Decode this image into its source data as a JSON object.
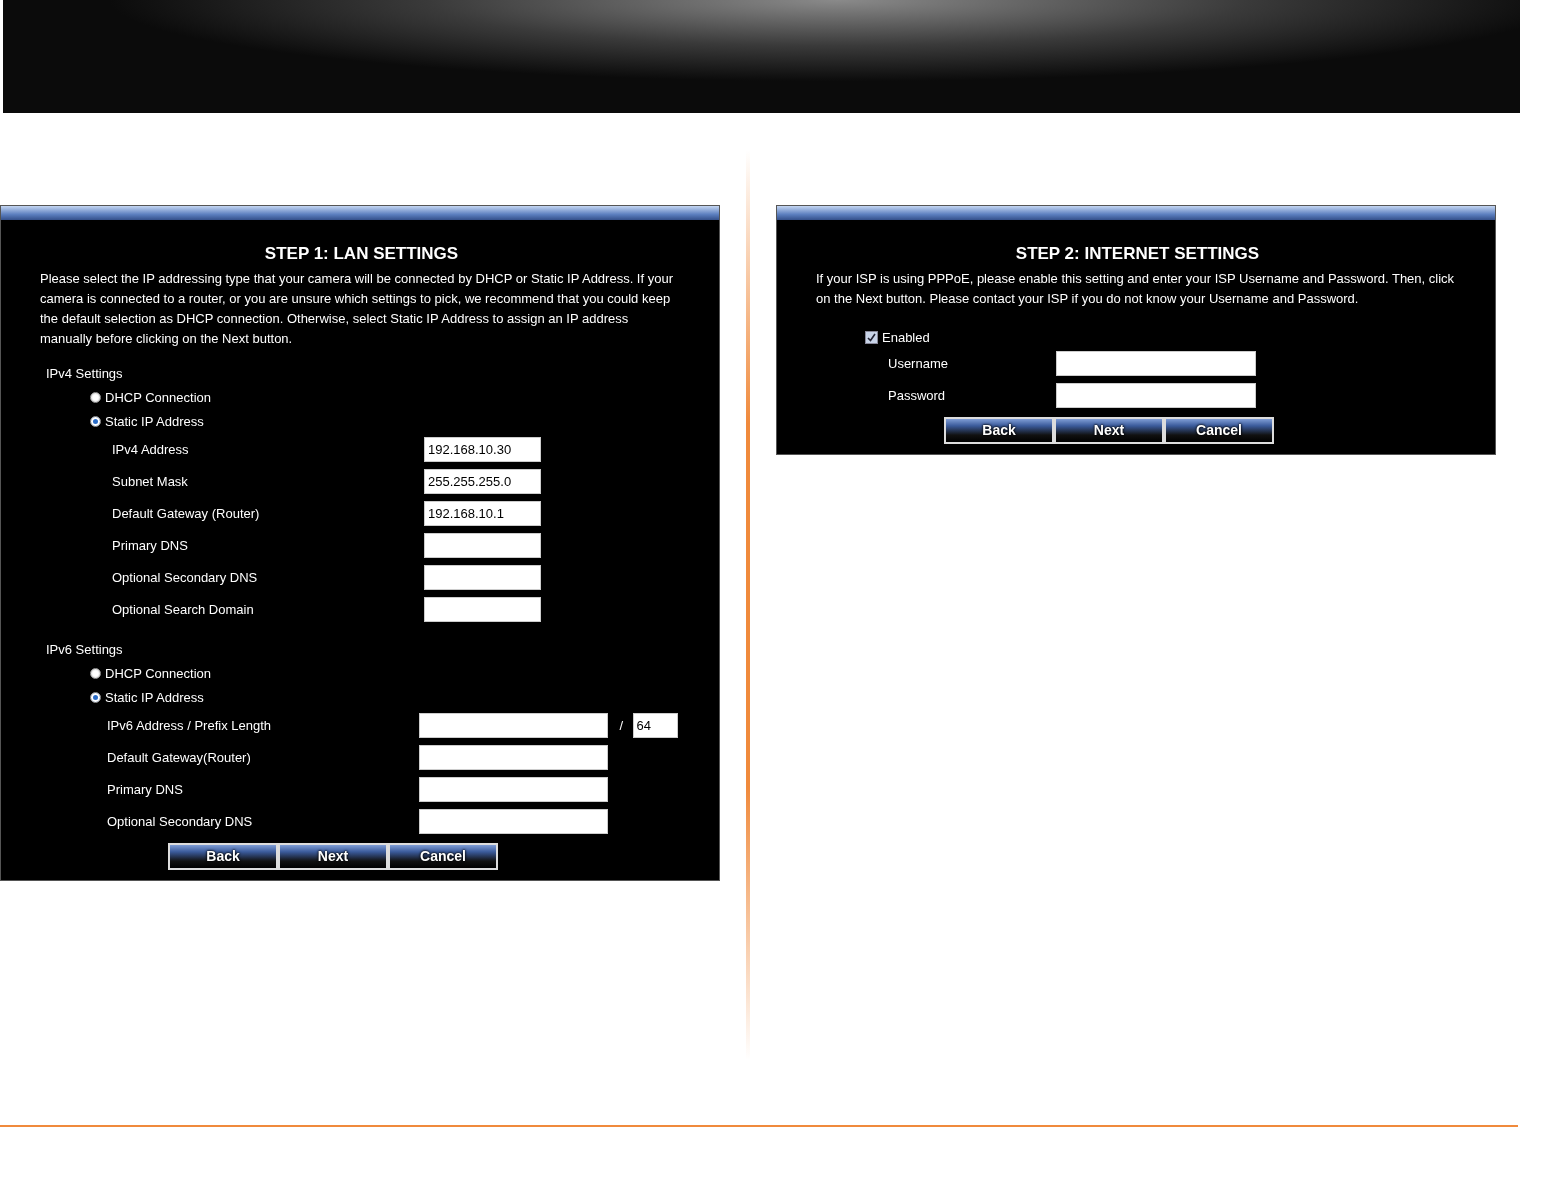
{
  "panels": [
    {
      "title": "STEP 1: LAN SETTINGS",
      "description": "Please select the IP addressing type that your camera will be connected by DHCP or Static IP Address. If your camera is connected to a router, or you are unsure which settings to pick, we recommend that you could keep the default selection as DHCP connection. Otherwise, select Static IP Address to assign an IP address manually before clicking on the Next button.",
      "sections": [
        {
          "heading": "IPv4 Settings",
          "options": [
            {
              "label": "DHCP Connection",
              "selected": false
            },
            {
              "label": "Static IP Address",
              "selected": true
            }
          ],
          "fields": [
            {
              "label": "IPv4 Address",
              "value": "192.168.10.30"
            },
            {
              "label": "Subnet Mask",
              "value": "255.255.255.0"
            },
            {
              "label": "Default Gateway (Router)",
              "value": "192.168.10.1"
            },
            {
              "label": "Primary DNS"
            },
            {
              "label": "Optional Secondary DNS"
            },
            {
              "label": "Optional Search Domain"
            }
          ]
        },
        {
          "heading": "IPv6 Settings",
          "options": [
            {
              "label": "DHCP Connection",
              "selected": false
            },
            {
              "label": "Static IP Address",
              "selected": true
            }
          ],
          "fields": [
            {
              "label": "IPv6 Address / Prefix Length",
              "separator": "/",
              "prefix_value": "64"
            },
            {
              "label": "Default Gateway(Router)"
            },
            {
              "label": "Primary DNS"
            },
            {
              "label": "Optional Secondary DNS"
            }
          ]
        }
      ],
      "buttons": [
        "Back",
        "Next",
        "Cancel"
      ]
    },
    {
      "title": "STEP 2: INTERNET SETTINGS",
      "description": "If your ISP is using PPPoE, please enable this setting and enter your ISP Username and Password. Then, click on the Next button. Please contact your ISP if you do not know your Username and Password.",
      "checkbox": {
        "label": "Enabled",
        "checked": true
      },
      "fields": [
        {
          "label": "Username"
        },
        {
          "label": "Password"
        }
      ],
      "buttons": [
        "Back",
        "Next",
        "Cancel"
      ]
    }
  ]
}
